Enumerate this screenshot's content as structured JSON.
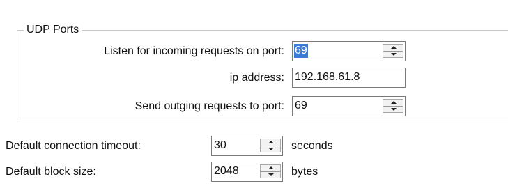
{
  "udp_group": {
    "title": "UDP Ports",
    "listen_label": "Listen for incoming requests on port:",
    "listen_port": "69",
    "ip_label": "ip address:",
    "ip_address": "192.168.61.8",
    "send_label": "Send outging requests to port:",
    "send_port": "69"
  },
  "timeout": {
    "label": "Default connection timeout:",
    "value": "30",
    "unit": "seconds"
  },
  "block_size": {
    "label": "Default block size:",
    "value": "2048",
    "unit": "bytes"
  },
  "icons": {
    "spinner_up": "up-arrow",
    "spinner_down": "down-arrow"
  }
}
